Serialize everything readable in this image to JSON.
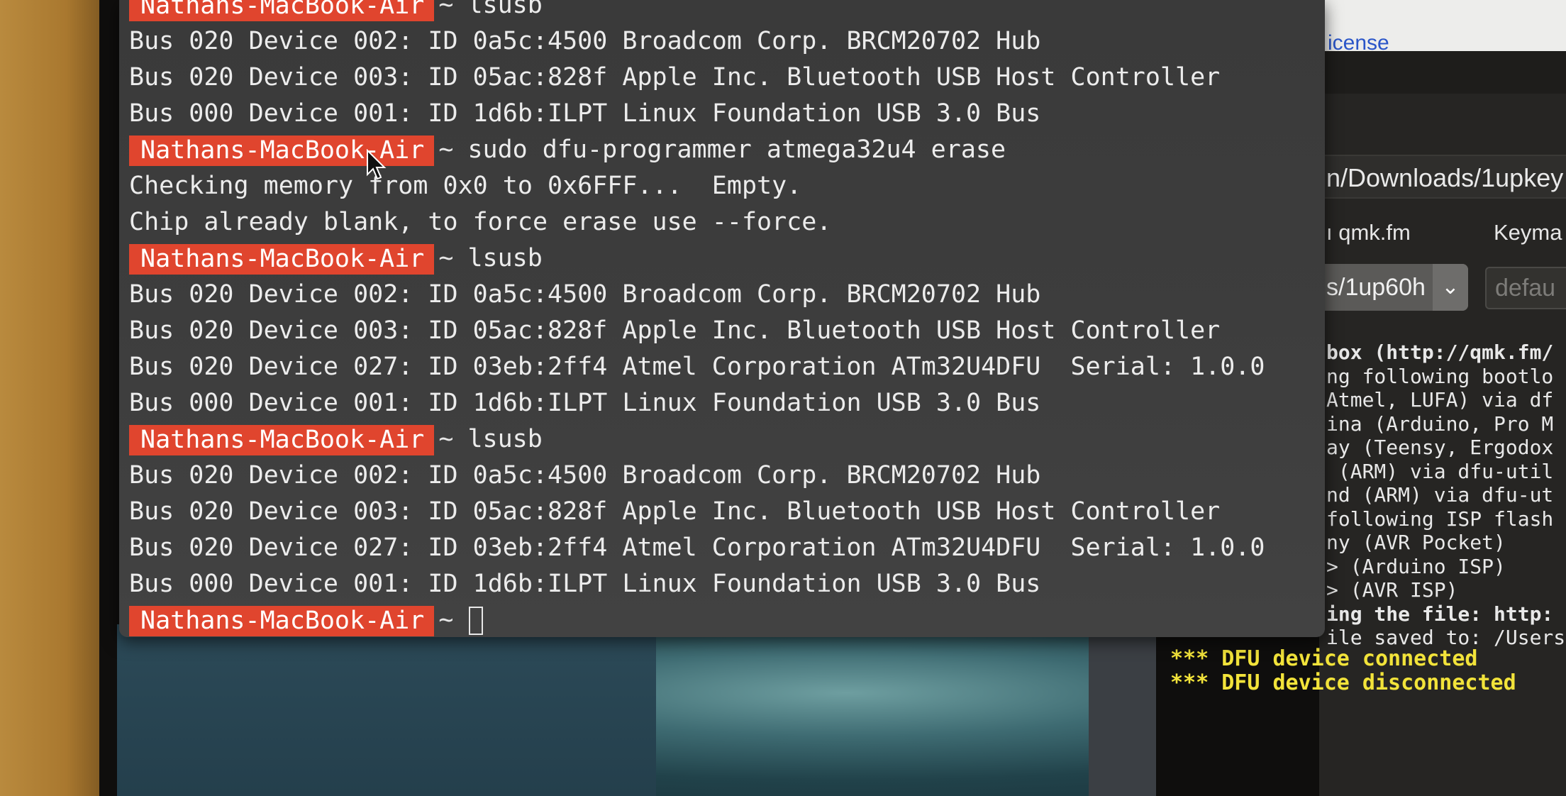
{
  "terminal": {
    "lines": [
      {
        "prompt": "Nathans-MacBook-Air",
        "command": "lsusb"
      },
      {
        "text": "Bus 020 Device 002: ID 0a5c:4500 Broadcom Corp. BRCM20702 Hub"
      },
      {
        "text": "Bus 020 Device 003: ID 05ac:828f Apple Inc. Bluetooth USB Host Controller"
      },
      {
        "text": "Bus 000 Device 001: ID 1d6b:ILPT Linux Foundation USB 3.0 Bus"
      },
      {
        "prompt": "Nathans-MacBook-Air",
        "command": "sudo dfu-programmer atmega32u4 erase"
      },
      {
        "text": "Checking memory from 0x0 to 0x6FFF...  Empty."
      },
      {
        "text": "Chip already blank, to force erase use --force."
      },
      {
        "prompt": "Nathans-MacBook-Air",
        "command": "lsusb"
      },
      {
        "text": "Bus 020 Device 002: ID 0a5c:4500 Broadcom Corp. BRCM20702 Hub"
      },
      {
        "text": "Bus 020 Device 003: ID 05ac:828f Apple Inc. Bluetooth USB Host Controller"
      },
      {
        "text": "Bus 020 Device 027: ID 03eb:2ff4 Atmel Corporation ATm32U4DFU  Serial: 1.0.0"
      },
      {
        "text": "Bus 000 Device 001: ID 1d6b:ILPT Linux Foundation USB 3.0 Bus"
      },
      {
        "prompt": "Nathans-MacBook-Air",
        "command": "lsusb"
      },
      {
        "text": "Bus 020 Device 002: ID 0a5c:4500 Broadcom Corp. BRCM20702 Hub"
      },
      {
        "text": "Bus 020 Device 003: ID 05ac:828f Apple Inc. Bluetooth USB Host Controller"
      },
      {
        "text": "Bus 020 Device 027: ID 03eb:2ff4 Atmel Corporation ATm32U4DFU  Serial: 1.0.0"
      },
      {
        "text": "Bus 000 Device 001: ID 1d6b:ILPT Linux Foundation USB 3.0 Bus"
      },
      {
        "prompt": "Nathans-MacBook-Air",
        "command": "",
        "cursor": true
      }
    ],
    "tilde": "~",
    "prompt_color": "#e0452e"
  },
  "qmk_toolbox": {
    "license_link": "icense",
    "path": "n/Downloads/1upkey",
    "label_qmk": "ı qmk.fm",
    "label_keymap": "Keyma",
    "keyboard_select": "s/1up60h",
    "keymap_placeholder": "defau",
    "log_lines": [
      "box (http://qmk.fm/",
      "ng following bootlo",
      "Atmel, LUFA) via df",
      "ina (Arduino, Pro M",
      "ay (Teensy, Ergodox",
      " (ARM) via dfu-util",
      "nd (ARM) via dfu-ut",
      "following ISP flash",
      "ny (AVR Pocket)",
      "> (Arduino ISP)",
      "> (AVR ISP)",
      "ing the file: http:",
      "ile saved to: /Users/natha"
    ],
    "dfu_events": [
      "*** DFU device connected",
      "*** DFU device disconnected"
    ],
    "accent_color": "#f2e33a"
  }
}
